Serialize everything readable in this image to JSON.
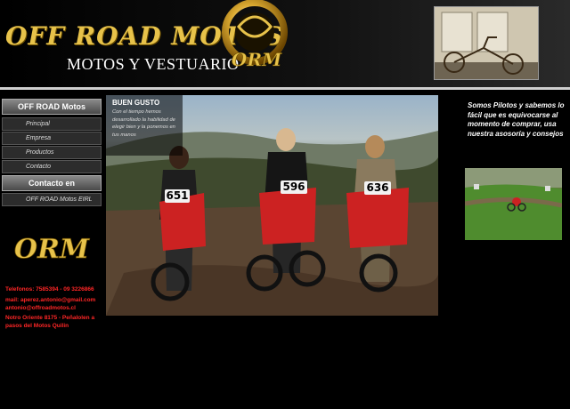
{
  "header": {
    "brand_title": "OFF ROAD MOTOS",
    "brand_subtitle": "MOTOS Y VESTUARIO",
    "emblem_letters": "ORM"
  },
  "nav": {
    "section_1": "OFF ROAD Motos",
    "items": [
      "Principal",
      "Empresa",
      "Productos",
      "Contacto"
    ],
    "section_2": "Contacto en",
    "sub_items": [
      "OFF ROAD Motos EIRL"
    ]
  },
  "sidebar_logo": "ORM",
  "contact": {
    "phones": "Telefonos:  7585394 - 09 3226866",
    "email_label": "mail: aperez.antonio@gmail.com",
    "email_2": "antonio@offroadmotos.cl",
    "address_1": "Notro Oriente 8175 - Peñalolen a",
    "address_2": "pasos del Motos Quilin"
  },
  "hero": {
    "overlay_title": "BUEN GUSTO",
    "overlay_text": "Con el tiempo hemos desarrollado la habilidad de elegir bien y la ponemos en tus manos",
    "plates": [
      "651",
      "596",
      "636"
    ]
  },
  "right": {
    "promo_text": "Somos Pilotos y sabemos lo fácil que es equivocarse al momento de comprar, usa nuestra asosoría y consejos"
  },
  "colors": {
    "brand_gold": "#e7c24a",
    "contact_red": "#ff2626",
    "background": "#000000"
  }
}
